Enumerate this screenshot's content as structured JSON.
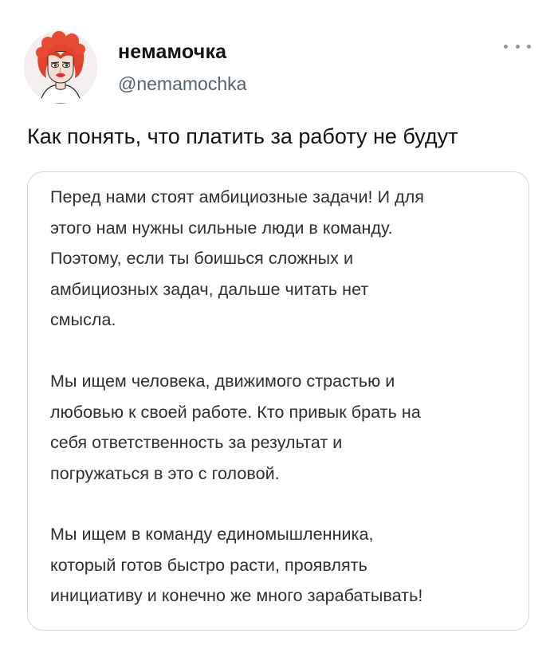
{
  "author": {
    "display_name": "немамочка",
    "handle": "@nemamochka",
    "avatar_icon": "avatar-redhead-woman",
    "more_icon": "more-dots-icon"
  },
  "tweet": {
    "text": "Как понять, что платить за работу не будут"
  },
  "quote": {
    "paragraphs": [
      {
        "lines": [
          "Перед нами стоят амбициозные задачи! И для",
          "этого нам нужны сильные люди в команду.",
          "Поэтому, если ты боишься сложных и",
          "амбициозных задач, дальше читать нет",
          "смысла."
        ]
      },
      {
        "lines": [
          "Мы ищем человека, движимого страстью и",
          "любовью к своей работе. Кто привык брать на",
          "себя ответственность за результат и",
          "погружаться в это с головой."
        ]
      },
      {
        "lines": [
          "Мы ищем в команду единомышленника,",
          "который готов быстро расти, проявлять",
          "инициативу и конечно же много зарабатывать!"
        ]
      }
    ]
  },
  "colors": {
    "text_primary": "#0f1419",
    "text_secondary": "#536471",
    "card_border": "#cfd9de",
    "avatar_hair": "#e0432e"
  }
}
